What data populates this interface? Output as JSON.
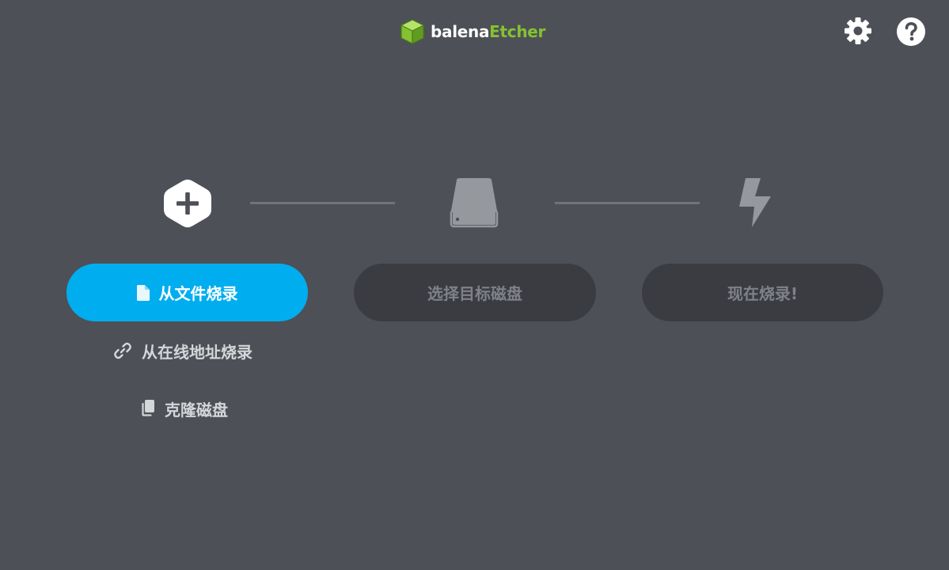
{
  "app": {
    "brand_part1": "balena",
    "brand_part2": "Etcher",
    "brand_color": "#85c232"
  },
  "header": {
    "settings_icon": "gear-icon",
    "help_icon": "question-icon"
  },
  "steps": {
    "source": {
      "icon": "plus-hexagon-icon",
      "button_label": "从文件烧录",
      "button_icon": "file-icon",
      "alt_url_label": "从在线地址烧录",
      "alt_url_icon": "link-icon",
      "alt_clone_label": "克隆磁盘",
      "alt_clone_icon": "copy-icon"
    },
    "target": {
      "icon": "drive-icon",
      "button_label": "选择目标磁盘"
    },
    "flash": {
      "icon": "lightning-icon",
      "button_label": "现在烧录!"
    }
  },
  "colors": {
    "background": "#4d5057",
    "primary": "#00aeef",
    "disabled_bg": "#3a3c41",
    "disabled_text": "#7e8187"
  }
}
